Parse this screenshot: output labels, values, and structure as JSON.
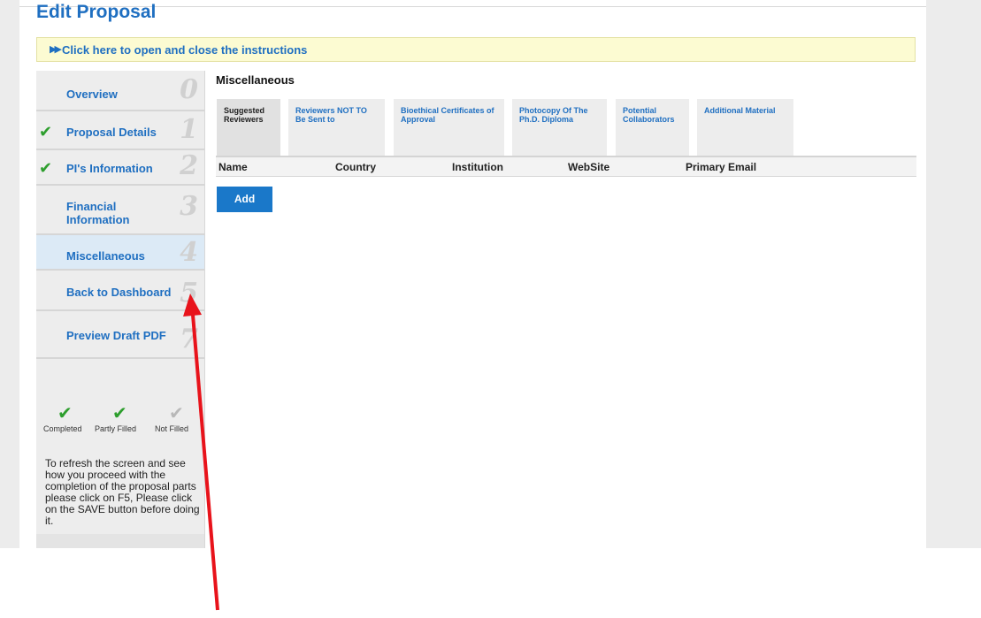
{
  "page": {
    "title": "Edit Proposal"
  },
  "instructions": {
    "label": "Click here to open and close the instructions",
    "icon": "double-chevron-right-icon"
  },
  "sidebar": {
    "items": [
      {
        "label": "Overview",
        "number": "0",
        "status": "none"
      },
      {
        "label": "Proposal Details",
        "number": "1",
        "status": "completed"
      },
      {
        "label": "PI's Information",
        "number": "2",
        "status": "completed"
      },
      {
        "label": "Financial Information",
        "number": "3",
        "status": "none"
      },
      {
        "label": "Miscellaneous",
        "number": "4",
        "status": "active"
      },
      {
        "label": "Back to Dashboard",
        "number": "5",
        "status": "none"
      },
      {
        "label": "Preview Draft PDF",
        "number": "7",
        "status": "none"
      }
    ],
    "legend": {
      "completed": "Completed",
      "partly": "Partly Filled",
      "not_filled": "Not Filled"
    },
    "help_text": "To refresh the screen and see how you proceed with the completion of the proposal parts please click on F5, Please click on the SAVE button before doing it."
  },
  "main": {
    "section_title": "Miscellaneous",
    "tabs": [
      {
        "label": "Suggested Reviewers",
        "active": true
      },
      {
        "label": "Reviewers NOT TO Be Sent to",
        "active": false
      },
      {
        "label": "Bioethical Certificates of Approval",
        "active": false
      },
      {
        "label": "Photocopy Of The Ph.D. Diploma",
        "active": false
      },
      {
        "label": "Potential Collaborators",
        "active": false
      },
      {
        "label": "Additional Material",
        "active": false
      }
    ],
    "table": {
      "columns": [
        "Name",
        "Country",
        "Institution",
        "WebSite",
        "Primary Email"
      ]
    },
    "add_button": "Add"
  },
  "colors": {
    "accent": "#1f6fc1",
    "check_green": "#2d9e2d",
    "annotation_arrow": "#e8131b",
    "button": "#1a78c9"
  }
}
